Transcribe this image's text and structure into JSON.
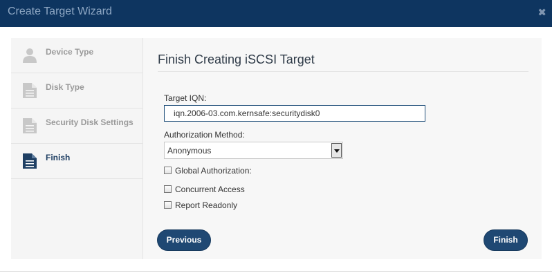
{
  "window": {
    "title": "Create Target Wizard",
    "close_icon": "close-icon"
  },
  "sidebar": {
    "steps": [
      {
        "label": "Device Type",
        "icon": "user-icon",
        "active": false
      },
      {
        "label": "Disk Type",
        "icon": "document-icon",
        "active": false
      },
      {
        "label": "Security Disk Settings",
        "icon": "document-icon",
        "active": false
      },
      {
        "label": "Finish",
        "icon": "document-icon",
        "active": true
      }
    ]
  },
  "main": {
    "title": "Finish Creating iSCSI Target",
    "target_iqn": {
      "label": "Target IQN:",
      "value": "iqn.2006-03.com.kernsafe:securitydisk0"
    },
    "auth_method": {
      "label": "Authorization Method:",
      "selected": "Anonymous"
    },
    "options": [
      {
        "label": "Global Authorization:",
        "checked": false
      },
      {
        "label": "Concurrent Access",
        "checked": false
      },
      {
        "label": "Report Readonly",
        "checked": false
      }
    ],
    "buttons": {
      "previous": "Previous",
      "finish": "Finish"
    }
  },
  "colors": {
    "titlebar": "#0e3560",
    "button": "#1f4873",
    "active_step": "#1f3f63",
    "inactive_step": "#9a9a9a"
  }
}
